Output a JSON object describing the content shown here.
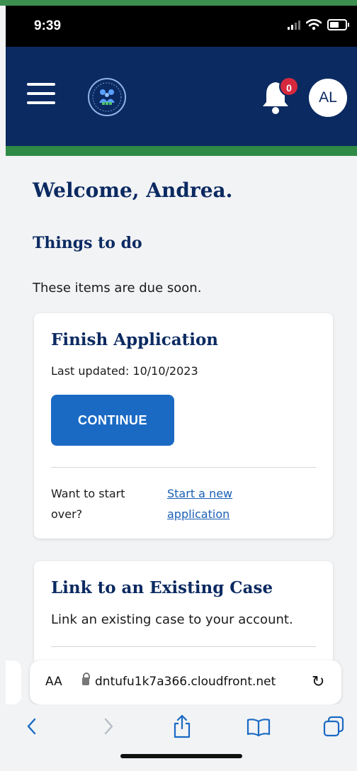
{
  "status_bar": {
    "time": "9:39"
  },
  "header": {
    "notification_count": "0",
    "avatar_initials": "AL"
  },
  "main": {
    "welcome": "Welcome, Andrea.",
    "things_title": "Things to do",
    "things_subtitle": "These items are due soon.",
    "cards": [
      {
        "title": "Finish Application",
        "last_updated": "Last updated: 10/10/2023",
        "button": "CONTINUE",
        "start_over_text": "Want to start over?",
        "start_new_link": "Start a new application"
      },
      {
        "title": "Link to an Existing Case",
        "text": "Link an existing case to your account."
      }
    ]
  },
  "browser": {
    "text_size": "AA",
    "url": "dntufu1k7a366.cloudfront.net"
  },
  "colors": {
    "navy": "#0b2a61",
    "green": "#2f8a46",
    "primary_button": "#1a6ac4",
    "badge": "#d6293e"
  },
  "icons": {
    "menu": "hamburger-icon",
    "logo": "department-seal-icon",
    "notifications": "bell-icon",
    "back": "chevron-left-icon",
    "forward": "chevron-right-icon",
    "share": "share-icon",
    "bookmarks": "book-icon",
    "tabs": "tabs-icon"
  }
}
